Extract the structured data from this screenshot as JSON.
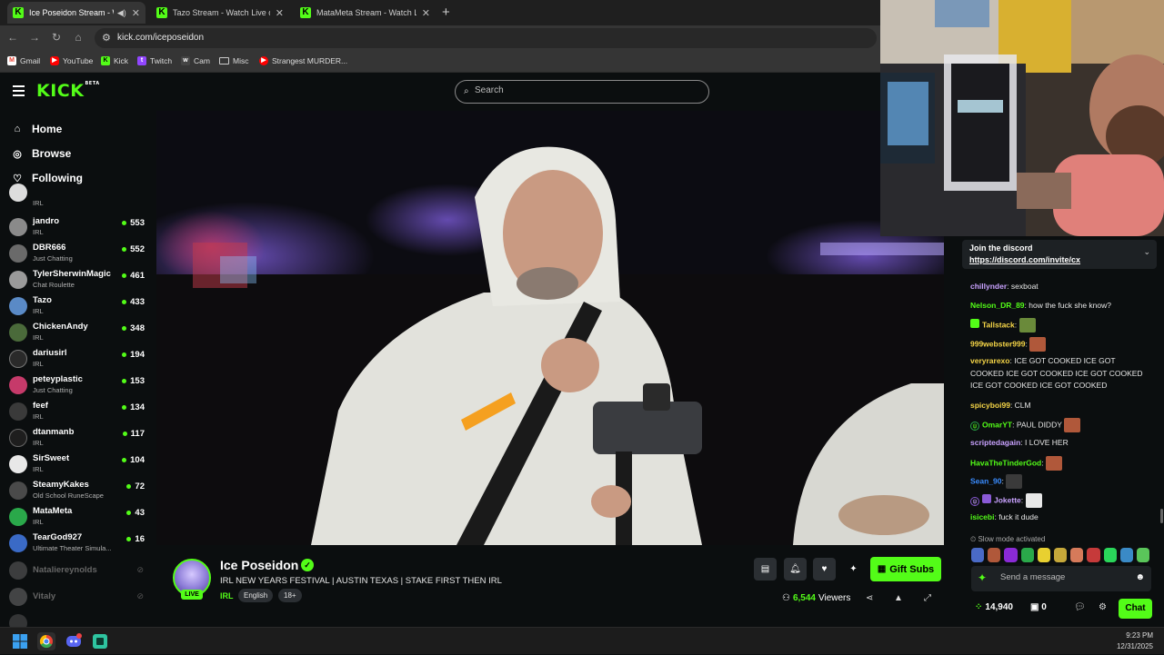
{
  "browser": {
    "tabs": [
      {
        "title": "Ice Poseidon Stream - Watch Live on Kick",
        "active": true,
        "audio": true
      },
      {
        "title": "Tazo Stream - Watch Live on Kick",
        "active": false
      },
      {
        "title": "MataMeta Stream - Watch Live on Kick",
        "active": false
      }
    ],
    "url": "kick.com/iceposeidon",
    "bookmarks": [
      {
        "label": "Gmail",
        "icon": "gmail-icon",
        "color": "#ea4335"
      },
      {
        "label": "YouTube",
        "icon": "youtube-icon",
        "color": "#ff0000"
      },
      {
        "label": "Kick",
        "icon": "kick-icon",
        "color": "#53fc18"
      },
      {
        "label": "Twitch",
        "icon": "twitch-icon",
        "color": "#9146ff"
      },
      {
        "label": "Cam",
        "icon": "cam-icon",
        "color": "#444"
      },
      {
        "label": "Misc",
        "icon": "folder-icon",
        "color": "none"
      },
      {
        "label": "Strangest MURDER...",
        "icon": "youtube-icon",
        "color": "#ff0000"
      }
    ]
  },
  "kick": {
    "logo": "KICK",
    "logo_badge": "BETA",
    "search_placeholder": "Search",
    "nav": [
      {
        "label": "Home",
        "icon": "home-icon"
      },
      {
        "label": "Browse",
        "icon": "compass-icon"
      },
      {
        "label": "Following",
        "icon": "heart-icon"
      }
    ],
    "channels": [
      {
        "name": "",
        "category": "IRL",
        "viewers": ""
      },
      {
        "name": "jandro",
        "category": "IRL",
        "viewers": "553"
      },
      {
        "name": "DBR666",
        "category": "Just Chatting",
        "viewers": "552"
      },
      {
        "name": "TylerSherwinMagic",
        "category": "Chat Roulette",
        "viewers": "461"
      },
      {
        "name": "Tazo",
        "category": "IRL",
        "viewers": "433"
      },
      {
        "name": "ChickenAndy",
        "category": "IRL",
        "viewers": "348"
      },
      {
        "name": "dariusirl",
        "category": "IRL",
        "viewers": "194"
      },
      {
        "name": "peteyplastic",
        "category": "Just Chatting",
        "viewers": "153"
      },
      {
        "name": "feef",
        "category": "IRL",
        "viewers": "134"
      },
      {
        "name": "dtanmanb",
        "category": "IRL",
        "viewers": "117"
      },
      {
        "name": "SirSweet",
        "category": "IRL",
        "viewers": "104"
      },
      {
        "name": "SteamyKakes",
        "category": "Old School RuneScape",
        "viewers": "72"
      },
      {
        "name": "MataMeta",
        "category": "IRL",
        "viewers": "43"
      },
      {
        "name": "TearGod927",
        "category": "Ultimate Theater Simula...",
        "viewers": "16"
      }
    ],
    "offline_channels": [
      {
        "name": "Nataliereynolds"
      },
      {
        "name": "Vitaly"
      }
    ]
  },
  "stream": {
    "streamer": "Ice Poseidon",
    "live_label": "LIVE",
    "title": "IRL NEW YEARS FESTIVAL | AUSTIN TEXAS | STAKE FIRST THEN IRL",
    "category": "IRL",
    "tags": [
      "English",
      "18+"
    ],
    "viewers": "6,544",
    "viewers_label": "Viewers",
    "gift_button": "Gift Subs"
  },
  "chat": {
    "pinned_title": "Join the discord",
    "pinned_link": "https://discord.com/invite/cx",
    "messages": [
      {
        "user": "chillynder",
        "color": "#c9a2ff",
        "text": "sexboat"
      },
      {
        "user": "Nelson_DR_89",
        "color": "#53fc18",
        "text": "how the fuck she know?"
      },
      {
        "user": "Tallstack",
        "color": "#f5d547",
        "text": "",
        "emote": "#6a8a3a",
        "badge": "#53fc18"
      },
      {
        "user": "999webster999",
        "color": "#f5d547",
        "text": "",
        "emote": "#b0583a"
      },
      {
        "user": "veryrarexo",
        "color": "#f5d547",
        "text": "ICE GOT COOKED ICE GOT COOKED ICE GOT COOKED ICE GOT COOKED ICE GOT COOKED ICE GOT COOKED"
      },
      {
        "user": "spicyboi99",
        "color": "#f5d547",
        "text": "CLM"
      },
      {
        "user": "OmarYT",
        "color": "#53fc18",
        "text": "PAUL DIDDY",
        "emote": "#b0583a",
        "badge": "#2a8a3a"
      },
      {
        "user": "scriptedagain",
        "color": "#c9a2ff",
        "text": "I LOVE HER"
      },
      {
        "user": "HavaTheTinderGod",
        "color": "#53fc18",
        "text": "",
        "emote": "#b0583a"
      },
      {
        "user": "Sean_90",
        "color": "#3a8cff",
        "text": "",
        "emote": "#3a3a3a"
      },
      {
        "user": "Jokette",
        "color": "#c9a2ff",
        "text": "",
        "emote": "#e8e8e8",
        "badge": "#8a5ad6"
      },
      {
        "user": "isicebi",
        "color": "#53fc18",
        "text": "fuck it dude"
      }
    ],
    "slow_mode": "Slow mode activated",
    "input_placeholder": "Send a message",
    "points": "14,940",
    "bombs": "0",
    "chat_button": "Chat"
  },
  "taskbar": {
    "time": "9:23 PM",
    "date": "12/31/2025"
  },
  "colors": {
    "kick_green": "#53fc18",
    "background": "#0b0e0f",
    "surface": "#1d2124"
  }
}
